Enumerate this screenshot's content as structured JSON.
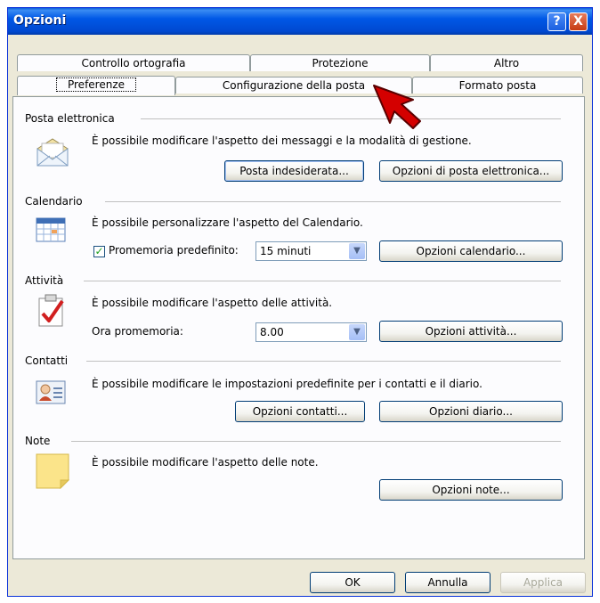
{
  "window": {
    "title": "Opzioni"
  },
  "tabs": {
    "row1": [
      "Controllo ortografia",
      "Protezione",
      "Altro"
    ],
    "row2": [
      "Preferenze",
      "Configurazione della posta",
      "Formato posta"
    ]
  },
  "sections": {
    "email": {
      "title": "Posta elettronica",
      "desc": "È possibile modificare l'aspetto dei messaggi e la modalità di gestione.",
      "btn_junk": "Posta indesiderata...",
      "btn_email_options": "Opzioni di posta elettronica..."
    },
    "calendar": {
      "title": "Calendario",
      "desc": "È possibile personalizzare l'aspetto del Calendario.",
      "reminder_label": "Promemoria predefinito:",
      "reminder_value": "15 minuti",
      "reminder_checked": true,
      "btn_calendar_options": "Opzioni calendario..."
    },
    "tasks": {
      "title": "Attività",
      "desc": "È possibile modificare l'aspetto delle attività.",
      "reminder_time_label": "Ora promemoria:",
      "reminder_time_value": "8.00",
      "btn_task_options": "Opzioni attività..."
    },
    "contacts": {
      "title": "Contatti",
      "desc": "È possibile modificare le impostazioni predefinite per i contatti e il diario.",
      "btn_contact_options": "Opzioni contatti...",
      "btn_journal_options": "Opzioni diario..."
    },
    "notes": {
      "title": "Note",
      "desc": "È possibile modificare l'aspetto delle note.",
      "btn_note_options": "Opzioni note..."
    }
  },
  "footer": {
    "ok": "OK",
    "cancel": "Annulla",
    "apply": "Applica"
  },
  "title_buttons": {
    "help": "?",
    "close": "X"
  },
  "icons": [
    "envelope-icon",
    "calendar-icon",
    "task-icon",
    "contact-card-icon",
    "note-icon",
    "cursor-arrow-icon"
  ],
  "colors": {
    "titlebar": "#0058e6",
    "dialog_bg": "#ece9d8",
    "cursor": "#d40000"
  }
}
